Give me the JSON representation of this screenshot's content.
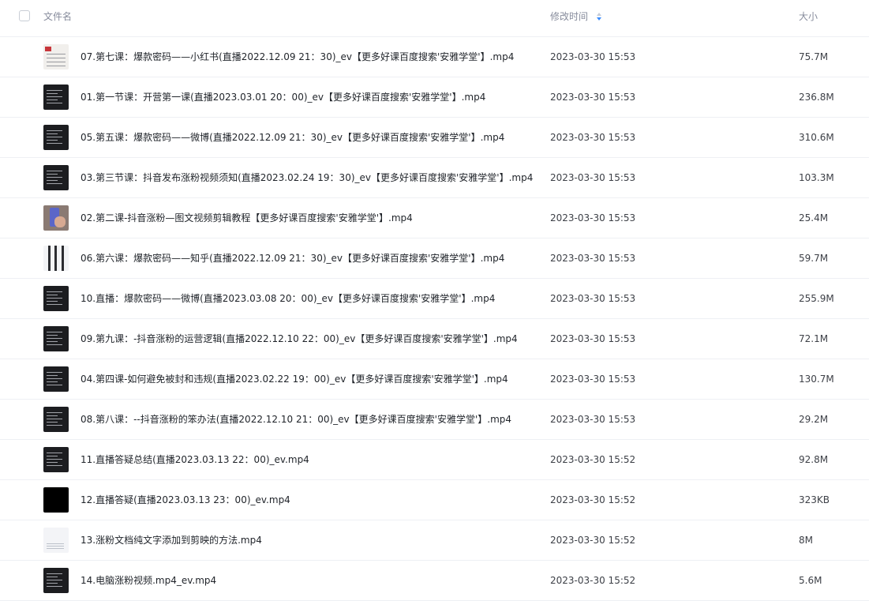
{
  "header": {
    "name_label": "文件名",
    "time_label": "修改时间",
    "size_label": "大小",
    "sort_icon": "sort-descending-icon",
    "accent": "#3a8cff"
  },
  "files": [
    {
      "name": "07.第七课：爆款密码——小红书(直播2022.12.09 21：30)_ev【更多好课百度搜索'安雅学堂'】.mp4",
      "time": "2023-03-30 15:53",
      "size": "75.7M",
      "thumb": "red-collage"
    },
    {
      "name": "01.第一节课：开营第一课(直播2023.03.01 20：00)_ev【更多好课百度搜索'安雅学堂'】.mp4",
      "time": "2023-03-30 15:53",
      "size": "236.8M",
      "thumb": "dark-slide"
    },
    {
      "name": "05.第五课：爆款密码——微博(直播2022.12.09 21：30)_ev【更多好课百度搜索'安雅学堂'】.mp4",
      "time": "2023-03-30 15:53",
      "size": "310.6M",
      "thumb": "dark-slide"
    },
    {
      "name": "03.第三节课：抖音发布涨粉视频须知(直播2023.02.24 19：30)_ev【更多好课百度搜索'安雅学堂'】.mp4",
      "time": "2023-03-30 15:53",
      "size": "103.3M",
      "thumb": "dark-slide"
    },
    {
      "name": "02.第二课-抖音涨粉—图文视频剪辑教程【更多好课百度搜索'安雅学堂'】.mp4",
      "time": "2023-03-30 15:53",
      "size": "25.4M",
      "thumb": "phone"
    },
    {
      "name": "06.第六课：爆款密码——知乎(直播2022.12.09 21：30)_ev【更多好课百度搜索'安雅学堂'】.mp4",
      "time": "2023-03-30 15:53",
      "size": "59.7M",
      "thumb": "strip"
    },
    {
      "name": "10.直播：爆款密码——微博(直播2023.03.08 20：00)_ev【更多好课百度搜索'安雅学堂'】.mp4",
      "time": "2023-03-30 15:53",
      "size": "255.9M",
      "thumb": "dark-slide"
    },
    {
      "name": "09.第九课：-抖音涨粉的运营逻辑(直播2022.12.10 22：00)_ev【更多好课百度搜索'安雅学堂'】.mp4",
      "time": "2023-03-30 15:53",
      "size": "72.1M",
      "thumb": "dark-slide"
    },
    {
      "name": "04.第四课-如何避免被封和违规(直播2023.02.22 19：00)_ev【更多好课百度搜索'安雅学堂'】.mp4",
      "time": "2023-03-30 15:53",
      "size": "130.7M",
      "thumb": "dark-slide"
    },
    {
      "name": "08.第八课：--抖音涨粉的笨办法(直播2022.12.10 21：00)_ev【更多好课百度搜索'安雅学堂'】.mp4",
      "time": "2023-03-30 15:53",
      "size": "29.2M",
      "thumb": "dark-slide"
    },
    {
      "name": "11.直播答疑总结(直播2023.03.13 22：00)_ev.mp4",
      "time": "2023-03-30 15:52",
      "size": "92.8M",
      "thumb": "dark-slide"
    },
    {
      "name": "12.直播答疑(直播2023.03.13 23：00)_ev.mp4",
      "time": "2023-03-30 15:52",
      "size": "323KB",
      "thumb": "black"
    },
    {
      "name": "13.涨粉文档纯文字添加到剪映的方法.mp4",
      "time": "2023-03-30 15:52",
      "size": "8M",
      "thumb": "doc"
    },
    {
      "name": "14.电脑涨粉视频.mp4_ev.mp4",
      "time": "2023-03-30 15:52",
      "size": "5.6M",
      "thumb": "dark-slide"
    }
  ]
}
